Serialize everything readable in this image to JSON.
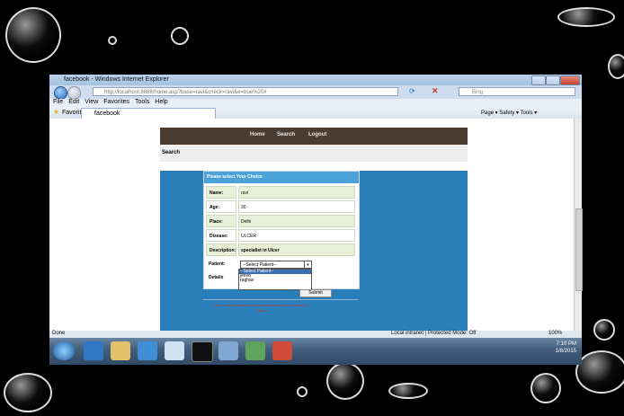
{
  "window": {
    "title": "facebook - Windows Internet Explorer",
    "url": "http://localhost:8888/home.asp?base=ravi&check=ravi&e=true%20#",
    "search_placeholder": "Bing",
    "menu": [
      "File",
      "Edit",
      "View",
      "Favorites",
      "Tools",
      "Help"
    ],
    "favorites_label": "Favorites",
    "tab_label": "facebook",
    "toolbar_right": "Page ▾  Safety ▾  Tools ▾",
    "status_left": "Done",
    "status_zone": "Local intranet | Protected Mode: Off",
    "zoom": "100%"
  },
  "page": {
    "nav": [
      "Home",
      "Search",
      "Logout"
    ],
    "search_heading": "Search",
    "form_title": "Please select Your Choice",
    "fields": [
      {
        "label": "Name:",
        "value": "ravi"
      },
      {
        "label": "Age:",
        "value": "30"
      },
      {
        "label": "Place:",
        "value": "Delhi"
      },
      {
        "label": "Disease:",
        "value": "ULCER"
      },
      {
        "label": "Description:",
        "value": "specialist in Ulcer"
      }
    ],
    "patient_label": "Patient:",
    "patient_selected": "--Select Patient--",
    "patient_options": [
      "--Select Patient--",
      "jeevo",
      "raghav"
    ],
    "details_label": "Details",
    "submit_label": "Submit",
    "footer_note": "Note: select patient from the dropdown and then submit the details"
  },
  "taskbar": {
    "time": "7:10 PM",
    "date": "1/8/2015"
  }
}
